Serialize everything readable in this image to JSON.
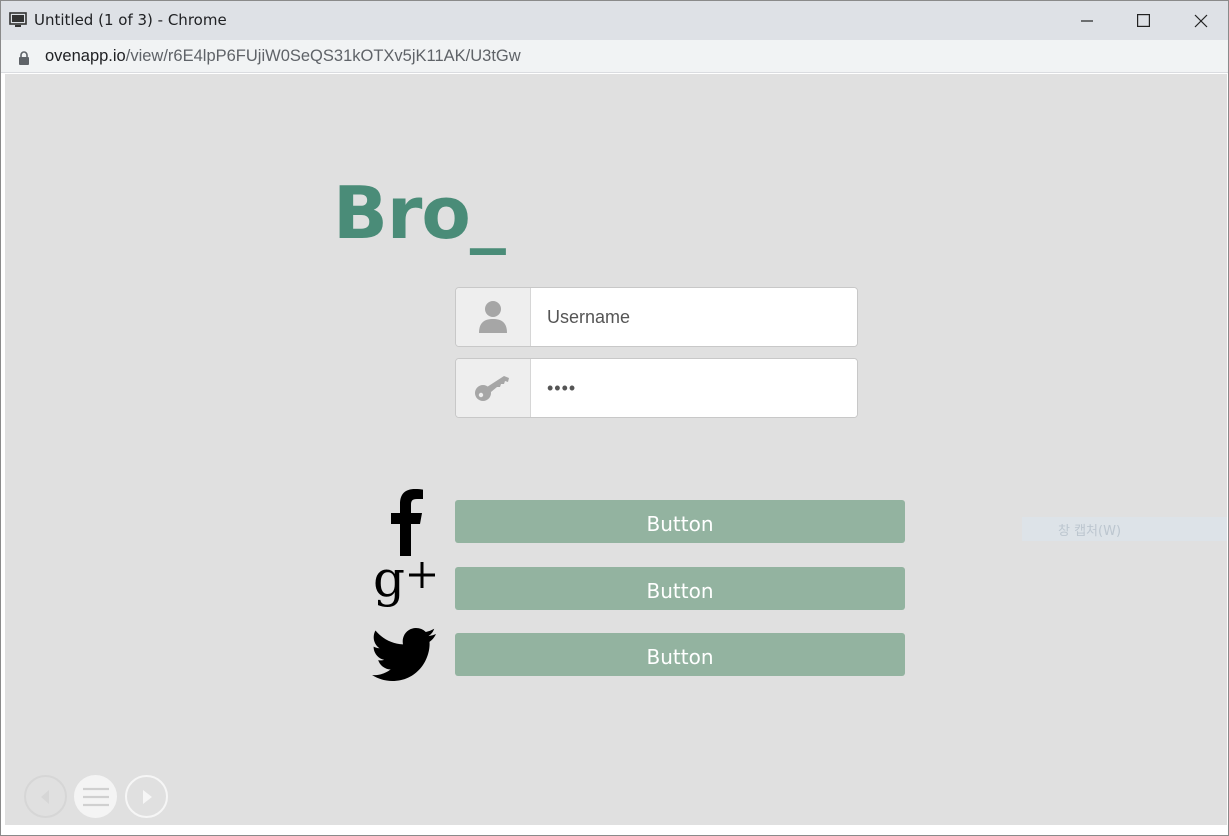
{
  "window": {
    "title": "Untitled (1 of 3) - Chrome"
  },
  "address": {
    "host": "ovenapp.io",
    "path": "/view/r6E4lpP6FUjiW0SeQS31kOTXv5jK11AK/U3tGw"
  },
  "app": {
    "logo": "Bro_",
    "accent_color": "#4a8c78",
    "button_color": "#93b3a0",
    "username": {
      "placeholder": "Username",
      "value": "",
      "icon": "user-icon"
    },
    "password": {
      "value": "••••",
      "icon": "key-icon"
    },
    "social": [
      {
        "icon": "facebook-icon",
        "label": "Button"
      },
      {
        "icon": "google-plus-icon",
        "label": "Button"
      },
      {
        "icon": "twitter-icon",
        "label": "Button"
      }
    ],
    "overlay_tip": "창 캡처(W)"
  },
  "player_nav": {
    "prev_icon": "prev-icon",
    "menu_icon": "menu-icon",
    "next_icon": "next-icon"
  }
}
